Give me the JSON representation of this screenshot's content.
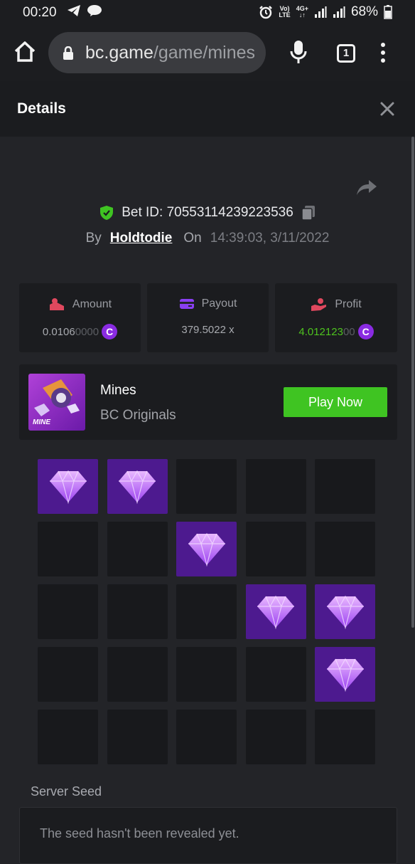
{
  "status_bar": {
    "time": "00:20",
    "battery": "68%",
    "net_tags": [
      "Vo)",
      "LTE",
      "4G+"
    ]
  },
  "browser": {
    "url_host": "bc.game",
    "url_path": "/game/mines",
    "tab_count": "1"
  },
  "modal": {
    "title": "Details"
  },
  "bet": {
    "label": "Bet ID:",
    "id": "70553114239223536",
    "by_label": "By",
    "user": "Holdtodie",
    "on_label": "On",
    "timestamp": "14:39:03, 3/11/2022"
  },
  "stats": {
    "amount": {
      "label": "Amount",
      "value_main": "0.0106",
      "value_dim": "0000"
    },
    "payout": {
      "label": "Payout",
      "value": "379.5022 x"
    },
    "profit": {
      "label": "Profit",
      "value_main": "4.012123",
      "value_dim": "00"
    },
    "coin_symbol": "C"
  },
  "game": {
    "name": "Mines",
    "provider": "BC Originals",
    "thumb_label": "MINE",
    "play_label": "Play Now"
  },
  "board": {
    "rows": 5,
    "cols": 5,
    "gems": [
      [
        0,
        0
      ],
      [
        0,
        1
      ],
      [
        1,
        2
      ],
      [
        2,
        3
      ],
      [
        2,
        4
      ],
      [
        3,
        4
      ]
    ]
  },
  "server_seed": {
    "label": "Server Seed",
    "text": "The seed hasn't been revealed yet."
  },
  "colors": {
    "accent_green": "#3fc422",
    "gem_tile": "#4d1a8f",
    "coin": "#8a2be2"
  }
}
